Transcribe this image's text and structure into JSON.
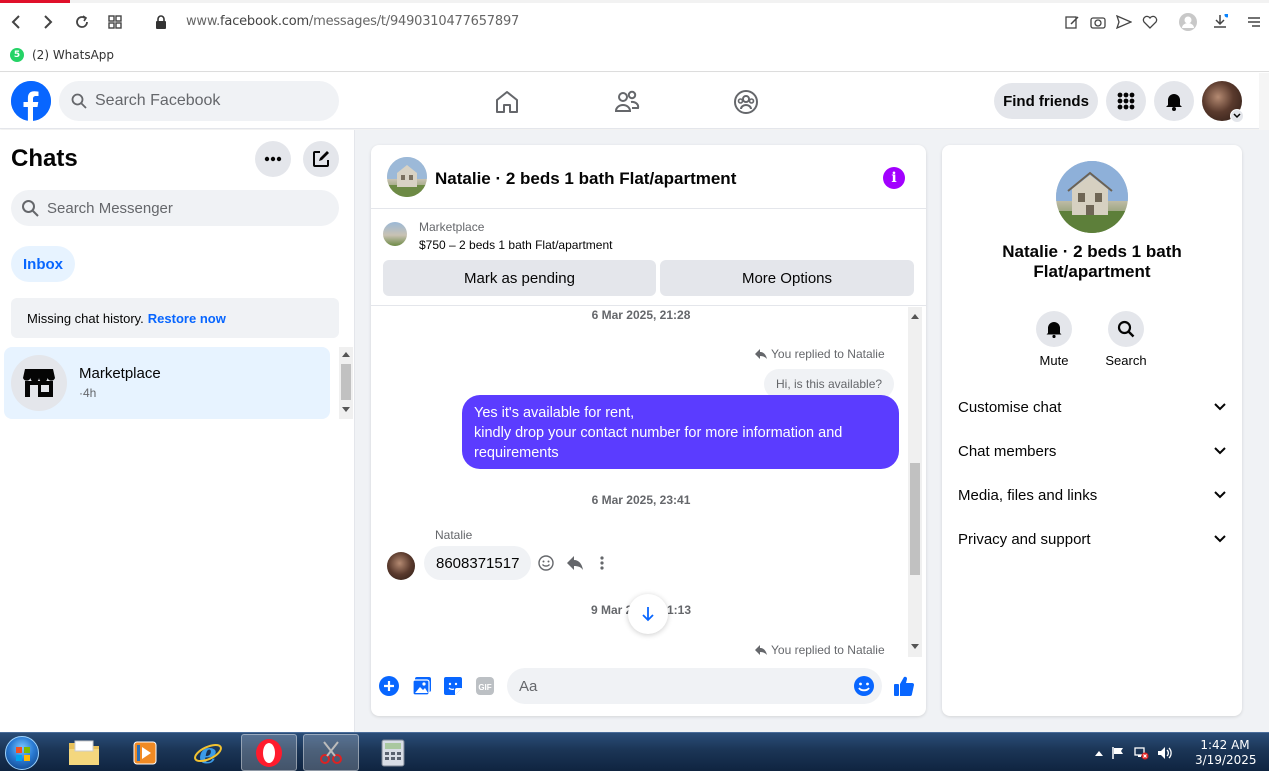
{
  "browser": {
    "url_prefix": "www.",
    "url_domain": "facebook.com",
    "url_path": "/messages/t/9490310477657897",
    "bookmark_label": "(2) WhatsApp",
    "bookmark_badge": "5"
  },
  "header": {
    "search_placeholder": "Search Facebook",
    "find_friends_label": "Find friends"
  },
  "sidebar": {
    "title": "Chats",
    "search_placeholder": "Search Messenger",
    "inbox_tab": "Inbox",
    "missing_history_text": "Missing chat history.",
    "restore_link": "Restore now",
    "chats": [
      {
        "name": "Marketplace",
        "time": "·4h"
      }
    ]
  },
  "conversation": {
    "title": "Natalie · 2 beds 1 bath Flat/apartment",
    "info_icon_glyph": "i",
    "listing": {
      "source": "Marketplace",
      "summary": "$750 – 2 beds 1 bath Flat/apartment",
      "pending_button": "Mark as pending",
      "more_button": "More Options"
    },
    "messages": {
      "date_1": "6 Mar 2025, 21:28",
      "replied_1": "You replied to Natalie",
      "quoted_1": "Hi, is this available?",
      "sent_1": "Yes it's available for rent,\n kindly drop your contact number for more information and requirements",
      "date_2": "6 Mar 2025, 23:41",
      "sender_name": "Natalie",
      "received_1": "8608371517",
      "date_3_left": "9 Mar 2",
      "date_3_right": "1:13",
      "replied_2": "You replied to Natalie"
    },
    "composer_placeholder": "Aa"
  },
  "info_panel": {
    "name": "Natalie · 2 beds 1 bath Flat/apartment",
    "actions": [
      {
        "label": "Mute",
        "icon": "bell-icon"
      },
      {
        "label": "Search",
        "icon": "search-icon"
      }
    ],
    "sections": [
      {
        "label": "Customise chat"
      },
      {
        "label": "Chat members"
      },
      {
        "label": "Media, files and links"
      },
      {
        "label": "Privacy and support"
      }
    ]
  },
  "taskbar": {
    "time": "1:42 AM",
    "date": "3/19/2025"
  },
  "colors": {
    "brand": "#0866ff",
    "sent_bubble": "#5b3cff",
    "info_icon": "#a200ff",
    "taskbar": "#1b3556"
  }
}
